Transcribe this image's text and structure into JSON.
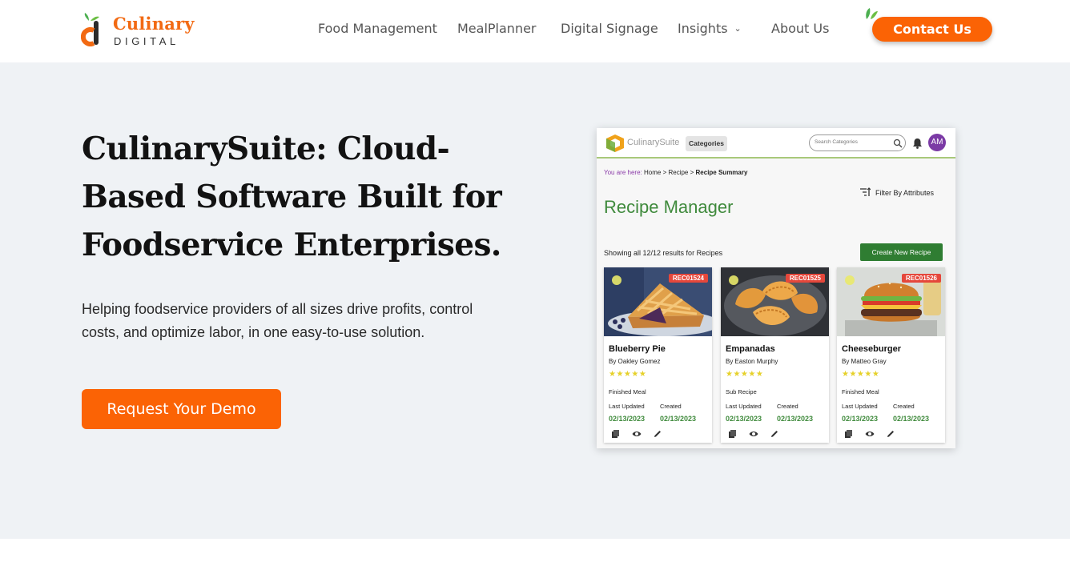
{
  "brand": {
    "title": "Culinary",
    "subtitle": "DIGITAL"
  },
  "nav": {
    "food_management": "Food Management",
    "meal_planner": "MealPlanner",
    "digital_signage": "Digital Signage",
    "insights": "Insights",
    "about_us": "About Us"
  },
  "contact_label": "Contact Us",
  "hero": {
    "title": "CulinarySuite: Cloud-Based Software Built for Foodservice Enterprises.",
    "description": "Helping foodservice providers of all sizes drive profits, control costs, and optimize labor, in one easy-to-use solution.",
    "demo_label": "Request Your Demo"
  },
  "app": {
    "logo_text": "CulinarySuite",
    "categories_label": "Categories",
    "search_placeholder": "Search Categories",
    "avatar_initials": "AM",
    "breadcrumb": {
      "prefix": "You are here:",
      "home": "Home",
      "recipe": "Recipe",
      "current": "Recipe Summary",
      "sep": ">"
    },
    "filter_label": "Filter By Attributes",
    "heading": "Recipe Manager",
    "results_text": "Showing all 12/12 results for Recipes",
    "create_label": "Create New Recipe",
    "labels": {
      "last_updated": "Last Updated",
      "created": "Created"
    },
    "cards": [
      {
        "tag": "REC01524",
        "name": "Blueberry Pie",
        "author": "By Oakley Gomez",
        "stars": "★★★★★",
        "type": "Finished Meal",
        "updated": "02/13/2023",
        "created": "02/13/2023"
      },
      {
        "tag": "REC01525",
        "name": "Empanadas",
        "author": "By Easton Murphy",
        "stars": "★★★★★",
        "type": "Sub Recipe",
        "updated": "02/13/2023",
        "created": "02/13/2023"
      },
      {
        "tag": "REC01526",
        "name": "Cheeseburger",
        "author": "By Matteo Gray",
        "stars": "★★★★★",
        "type": "Finished Meal",
        "updated": "02/13/2023",
        "created": "02/13/2023"
      }
    ]
  },
  "colors": {
    "accent": "#fb6305",
    "hero_bg": "#eff2f5",
    "app_green": "#3f8a3c",
    "avatar": "#7b3aa5"
  }
}
